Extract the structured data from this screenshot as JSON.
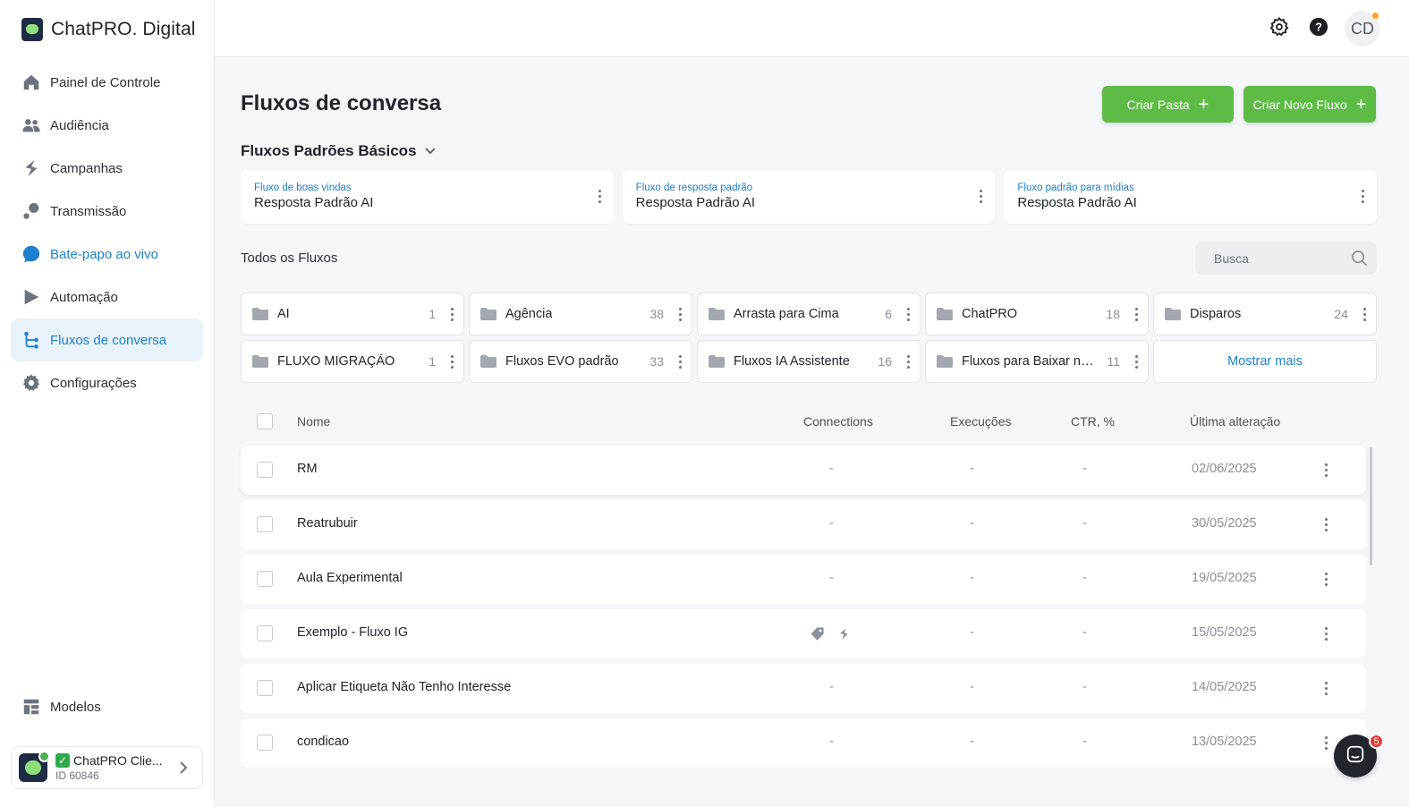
{
  "brand": {
    "name": "ChatPRO. Digital"
  },
  "sidebar": {
    "items": [
      {
        "label": "Painel de Controle",
        "icon": "home-icon"
      },
      {
        "label": "Audiência",
        "icon": "users-icon"
      },
      {
        "label": "Campanhas",
        "icon": "campaign-icon"
      },
      {
        "label": "Transmissão",
        "icon": "broadcast-icon"
      },
      {
        "label": "Bate-papo ao vivo",
        "icon": "chat-icon"
      },
      {
        "label": "Automação",
        "icon": "automation-icon"
      },
      {
        "label": "Fluxos de conversa",
        "icon": "flow-icon"
      },
      {
        "label": "Configurações",
        "icon": "gear-icon"
      }
    ],
    "bottom": {
      "label": "Modelos",
      "icon": "templates-icon"
    },
    "account": {
      "name": "ChatPRO Clie...",
      "id": "ID 60846"
    }
  },
  "topbar": {
    "avatar_initials": "CD"
  },
  "page": {
    "title": "Fluxos de conversa",
    "create_folder": "Criar Pasta",
    "create_flow": "Criar Novo Fluxo",
    "defaults_title": "Fluxos Padrões Básicos",
    "defaults": [
      {
        "label": "Fluxo de boas vindas",
        "value": "Resposta Padrão AI"
      },
      {
        "label": "Fluxo de resposta padrão",
        "value": "Resposta Padrão AI"
      },
      {
        "label": "Fluxo padrão para mídias",
        "value": "Resposta Padrão AI"
      }
    ],
    "all_title": "Todos os Fluxos",
    "search_placeholder": "Busca"
  },
  "folders": [
    {
      "name": "AI",
      "count": "1"
    },
    {
      "name": "Agência",
      "count": "38"
    },
    {
      "name": "Arrasta para Cima",
      "count": "6"
    },
    {
      "name": "ChatPRO",
      "count": "18"
    },
    {
      "name": "Disparos",
      "count": "24"
    },
    {
      "name": "FLUXO MIGRAÇÃO",
      "count": "1"
    },
    {
      "name": "Fluxos EVO padrão",
      "count": "33"
    },
    {
      "name": "Fluxos IA Assistente",
      "count": "16"
    },
    {
      "name": "Fluxos para Baixar no...",
      "count": "11"
    }
  ],
  "show_more": "Mostrar mais",
  "table": {
    "headers": {
      "name": "Nome",
      "connections": "Connections",
      "executions": "Execuções",
      "ctr": "CTR, %",
      "last_modified": "Última alteração"
    },
    "rows": [
      {
        "name": "RM",
        "connections": "-",
        "executions": "-",
        "ctr": "-",
        "date": "02/06/2025"
      },
      {
        "name": "Reatrubuir",
        "connections": "-",
        "executions": "-",
        "ctr": "-",
        "date": "30/05/2025"
      },
      {
        "name": "Aula Experimental",
        "connections": "-",
        "executions": "-",
        "ctr": "-",
        "date": "19/05/2025"
      },
      {
        "name": "Exemplo - Fluxo IG",
        "connections": "",
        "executions": "-",
        "ctr": "-",
        "date": "15/05/2025"
      },
      {
        "name": "Aplicar Etiqueta Não Tenho Interesse",
        "connections": "-",
        "executions": "-",
        "ctr": "-",
        "date": "14/05/2025"
      },
      {
        "name": "condicao",
        "connections": "-",
        "executions": "-",
        "ctr": "-",
        "date": "13/05/2025"
      }
    ]
  },
  "chat_widget": {
    "badge": "5"
  },
  "colors": {
    "accent": "#1e7fcf",
    "primary_button": "#5dbb46",
    "active_bg": "#e8f2fb"
  }
}
